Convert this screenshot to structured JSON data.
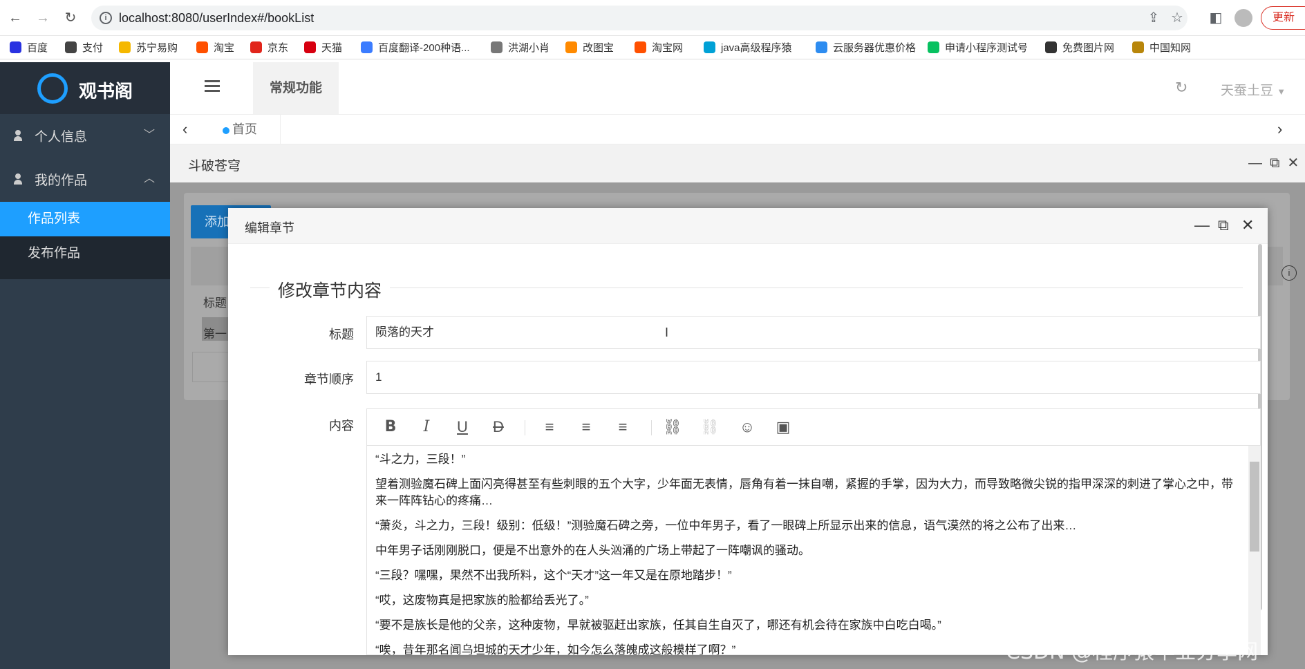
{
  "browser": {
    "url": "localhost:8080/userIndex#/bookList",
    "update_label": "更新",
    "bookmarks": [
      {
        "label": "百度",
        "color": "#2932e1"
      },
      {
        "label": "支付",
        "color": "#444444"
      },
      {
        "label": "苏宁易购",
        "color": "#f5b800"
      },
      {
        "label": "淘宝",
        "color": "#ff5000"
      },
      {
        "label": "京东",
        "color": "#e1251b"
      },
      {
        "label": "天猫",
        "color": "#d70010"
      },
      {
        "label": "百度翻译-200种语...",
        "color": "#3b7cff"
      },
      {
        "label": "洪湖小肖",
        "color": "#777777"
      },
      {
        "label": "改图宝",
        "color": "#ff8a00"
      },
      {
        "label": "淘宝网",
        "color": "#ff5000"
      },
      {
        "label": "java高级程序猿",
        "color": "#00a1d6"
      },
      {
        "label": "云服务器优惠价格",
        "color": "#2d8cf0"
      },
      {
        "label": "申请小程序测试号",
        "color": "#07c160"
      },
      {
        "label": "免费图片网",
        "color": "#333333"
      },
      {
        "label": "中国知网",
        "color": "#b8860b"
      }
    ]
  },
  "app": {
    "logo_text": "观书阁",
    "header_tab": "常规功能",
    "user_name": "天蚕土豆",
    "home_tab": "首页"
  },
  "sidebar": {
    "items": [
      {
        "label": "个人信息",
        "chevron": "﹀"
      },
      {
        "label": "我的作品",
        "chevron": "︿"
      }
    ],
    "sub_items": [
      {
        "label": "作品列表"
      },
      {
        "label": "发布作品"
      }
    ]
  },
  "page": {
    "book_title": "斗破苍穹",
    "bg_add_label": "添加",
    "bg_title_label": "标题",
    "bg_row_label": "第一"
  },
  "dialog": {
    "title": "编辑章节",
    "legend": "修改章节内容",
    "title_label": "标题",
    "title_value": "陨落的天才",
    "order_label": "章节顺序",
    "order_value": "1",
    "content_label": "内容",
    "paragraphs": [
      "“斗之力，三段！”",
      "望着测验魔石碑上面闪亮得甚至有些刺眼的五个大字，少年面无表情，唇角有着一抹自嘲，紧握的手掌，因为大力，而导致略微尖锐的指甲深深的刺进了掌心之中，带来一阵阵钻心的疼痛…",
      "“萧炎，斗之力，三段！级别：低级！”测验魔石碑之旁，一位中年男子，看了一眼碑上所显示出来的信息，语气漠然的将之公布了出来…",
      "中年男子话刚刚脱口，便是不出意外的在人头汹涌的广场上带起了一阵嘲讽的骚动。",
      "“三段？嘿嘿，果然不出我所料，这个“天才”这一年又是在原地踏步！”",
      "“哎，这废物真是把家族的脸都给丢光了。”",
      "“要不是族长是他的父亲，这种废物，早就被驱赶出家族，任其自生自灭了，哪还有机会待在家族中白吃白喝。”",
      "“唉，昔年那名闻乌坦城的天才少年，如今怎么落魄成这般模样了啊？”"
    ]
  },
  "watermark": "CSDN @程序猿毕业分享网"
}
